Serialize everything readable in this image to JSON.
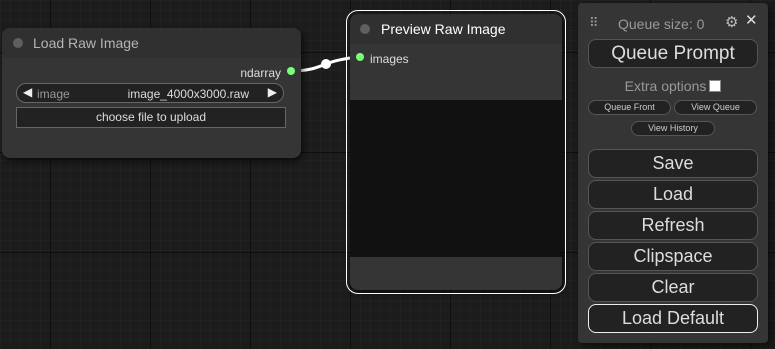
{
  "load_node": {
    "title": "Load Raw Image",
    "output_label": "ndarray",
    "image_widget": {
      "name": "image",
      "value": "image_4000x3000.raw",
      "left_arrow": "◀",
      "right_arrow": "▶"
    },
    "upload_button": "choose file to upload"
  },
  "preview_node": {
    "title": "Preview Raw Image",
    "input_label": "images"
  },
  "menu": {
    "drag_handle": "⠿",
    "queue_size": "Queue size: 0",
    "settings_icon": "⚙",
    "close_icon": "✕",
    "queue_prompt": "Queue Prompt",
    "extra_options": "Extra options",
    "queue_front": "Queue Front",
    "view_queue": "View Queue",
    "view_history": "View History",
    "save": "Save",
    "load": "Load",
    "refresh": "Refresh",
    "clipspace": "Clipspace",
    "clear": "Clear",
    "load_default": "Load Default"
  },
  "colors": {
    "slot_dot": "#77ff77",
    "canvas": "#1c1c1c",
    "node": "#353535"
  }
}
